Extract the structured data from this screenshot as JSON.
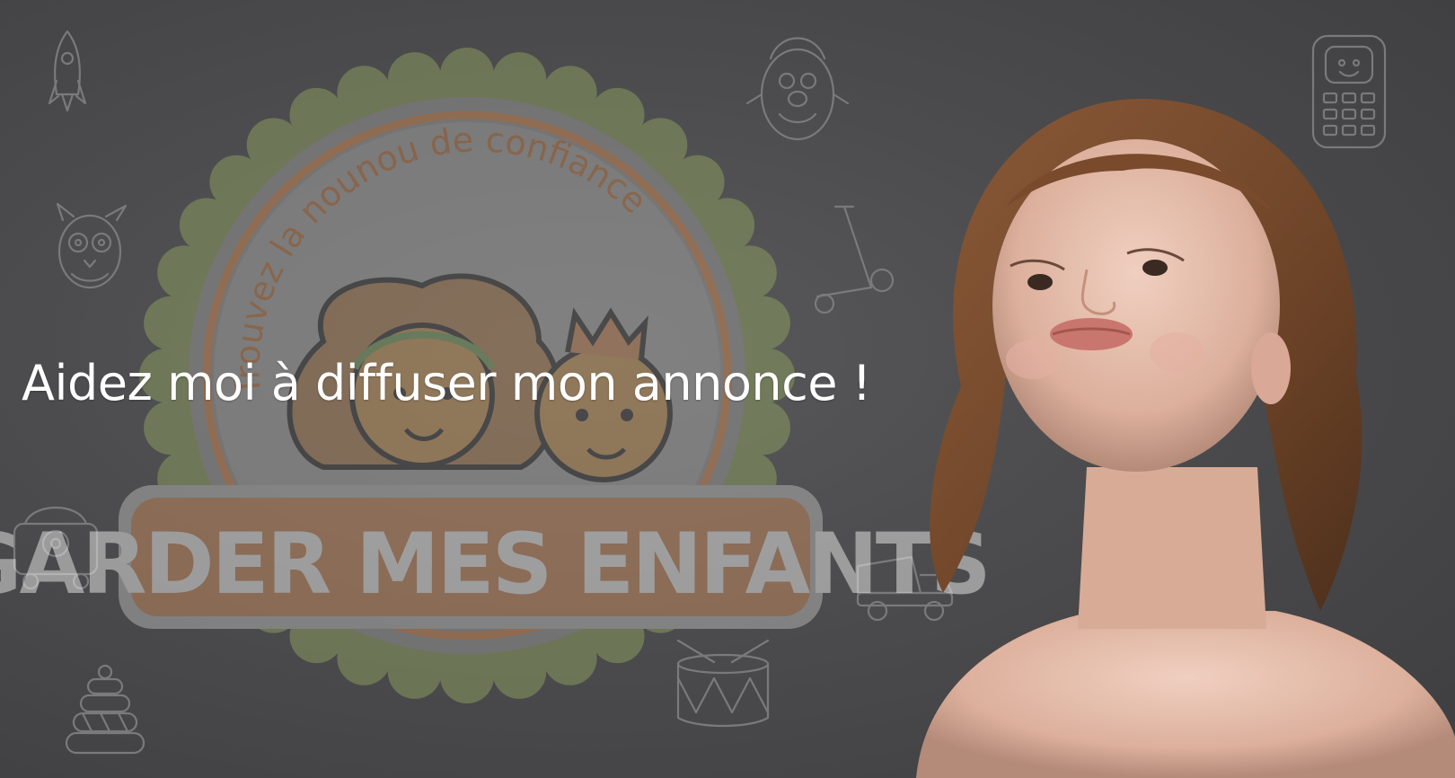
{
  "hero": {
    "headline": "Aidez moi à diffuser mon annonce !",
    "background_color": "#4a4a4c",
    "text_color": "#ffffff"
  },
  "logo": {
    "tagline": "Trouvez la nounou de confiance",
    "brand": "GARDER MES ENFANTS",
    "scallop_color": "#8ea060",
    "ring_color": "#cf8a55",
    "banner_color": "#c98b5e"
  },
  "icons": [
    "rocket-icon",
    "owl-toy-icon",
    "toy-phone-icon",
    "stacking-rings-icon",
    "potato-head-icon",
    "scooter-icon",
    "dump-truck-icon",
    "drum-icon",
    "toy-mobile-phone-icon"
  ]
}
